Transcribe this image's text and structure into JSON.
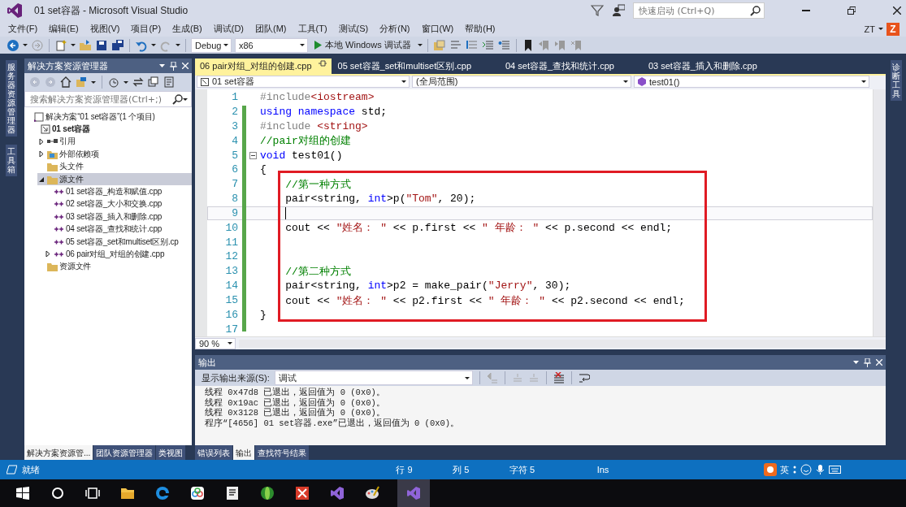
{
  "window": {
    "title": "01 set容器 - Microsoft Visual Studio",
    "quick_launch": {
      "placeholder": "快速启动 (Ctrl+Q)"
    },
    "account": {
      "name": "ZT",
      "initial": "Z"
    }
  },
  "menu": [
    "文件(F)",
    "编辑(E)",
    "视图(V)",
    "项目(P)",
    "生成(B)",
    "调试(D)",
    "团队(M)",
    "工具(T)",
    "测试(S)",
    "分析(N)",
    "窗口(W)",
    "帮助(H)"
  ],
  "toolbar": {
    "configuration": "Debug",
    "platform": "x86",
    "start": "本地 Windows 调试器"
  },
  "side_strips": {
    "left": [
      "服务器资源管理器",
      "工具箱"
    ],
    "right": [
      "诊断工具"
    ]
  },
  "solution_explorer": {
    "title": "解决方案资源管理器",
    "search": {
      "placeholder": "搜索解决方案资源管理器(Ctrl+;)"
    },
    "tree": [
      {
        "label": "解决方案“01 set容器”(1 个项目)",
        "kind": "solution",
        "selected": false,
        "children": [
          {
            "label": "01 set容器",
            "kind": "project",
            "selected": false,
            "children": [
              {
                "label": "引用",
                "kind": "references",
                "expanded": false,
                "selected": false
              },
              {
                "label": "外部依赖项",
                "kind": "dependencies",
                "expanded": false,
                "selected": false
              },
              {
                "label": "头文件",
                "kind": "folder",
                "selected": false
              },
              {
                "label": "源文件",
                "kind": "folder",
                "expanded": true,
                "selected": true,
                "children": [
                  {
                    "label": "01 set容器_构造和赋值.cpp",
                    "kind": "file",
                    "selected": false
                  },
                  {
                    "label": "02 set容器_大小和交换.cpp",
                    "kind": "file",
                    "selected": false
                  },
                  {
                    "label": "03 set容器_插入和删除.cpp",
                    "kind": "file",
                    "selected": false
                  },
                  {
                    "label": "04 set容器_查找和统计.cpp",
                    "kind": "file",
                    "selected": false
                  },
                  {
                    "label": "05 set容器_set和multiset区别.cp",
                    "kind": "file",
                    "selected": false
                  },
                  {
                    "label": "06 pair对组_对组的创建.cpp",
                    "kind": "file",
                    "expanded": false,
                    "selected": false
                  }
                ]
              },
              {
                "label": "资源文件",
                "kind": "folder",
                "selected": false
              }
            ]
          }
        ]
      }
    ],
    "tabs": [
      {
        "label": "解决方案资源管...",
        "selected": true
      },
      {
        "label": "团队资源管理器",
        "selected": false
      },
      {
        "label": "类视图",
        "selected": false
      }
    ]
  },
  "editor": {
    "tabs": [
      {
        "label": "06 pair对组_对组的创建.cpp",
        "selected": true
      },
      {
        "label": "05 set容器_set和multiset区别.cpp",
        "selected": false
      },
      {
        "label": "04 set容器_查找和统计.cpp",
        "selected": false
      },
      {
        "label": "03 set容器_插入和删除.cpp",
        "selected": false
      }
    ],
    "nav": [
      "01 set容器",
      "(全局范围)",
      "test01()"
    ],
    "lines": [
      {
        "number": "1",
        "current": false,
        "foldable": false,
        "tokens": [
          {
            "t": "#include",
            "kind": "pre"
          },
          {
            "t": "<iostream>",
            "kind": "inc"
          }
        ]
      },
      {
        "number": "2",
        "current": false,
        "foldable": false,
        "tokens": [
          {
            "t": "using namespace",
            "kind": "kw"
          },
          {
            "t": " std;",
            "kind": "plain"
          }
        ]
      },
      {
        "number": "3",
        "current": false,
        "foldable": false,
        "tokens": [
          {
            "t": "#include ",
            "kind": "pre"
          },
          {
            "t": "<string>",
            "kind": "inc"
          }
        ]
      },
      {
        "number": "4",
        "current": false,
        "foldable": false,
        "tokens": [
          {
            "t": "//pair对组的创建",
            "kind": "com"
          }
        ]
      },
      {
        "number": "5",
        "current": false,
        "foldable": true,
        "tokens": [
          {
            "t": "void",
            "kind": "kw"
          },
          {
            "t": " test01()",
            "kind": "plain"
          }
        ]
      },
      {
        "number": "6",
        "current": false,
        "foldable": false,
        "tokens": [
          {
            "t": "{",
            "kind": "plain"
          }
        ]
      },
      {
        "number": "7",
        "current": false,
        "foldable": false,
        "tokens": [
          {
            "t": "    //第一种方式",
            "kind": "com"
          }
        ]
      },
      {
        "number": "8",
        "current": false,
        "foldable": false,
        "tokens": [
          {
            "t": "    pair<string, ",
            "kind": "plain"
          },
          {
            "t": "int",
            "kind": "kw"
          },
          {
            "t": ">p(",
            "kind": "plain"
          },
          {
            "t": "\"Tom\"",
            "kind": "str"
          },
          {
            "t": ", 20);",
            "kind": "plain"
          }
        ]
      },
      {
        "number": "9",
        "current": true,
        "foldable": false
      },
      {
        "number": "10",
        "current": false,
        "foldable": false,
        "tokens": [
          {
            "t": "    cout << ",
            "kind": "plain"
          },
          {
            "t": "\"姓名： \"",
            "kind": "str"
          },
          {
            "t": " << p.first << ",
            "kind": "plain"
          },
          {
            "t": "\" 年龄： \"",
            "kind": "str"
          },
          {
            "t": " << p.second << endl;",
            "kind": "plain"
          }
        ]
      },
      {
        "number": "11",
        "current": false,
        "foldable": false
      },
      {
        "number": "12",
        "current": false,
        "foldable": false
      },
      {
        "number": "13",
        "current": false,
        "foldable": false,
        "tokens": [
          {
            "t": "    //第二种方式",
            "kind": "com"
          }
        ]
      },
      {
        "number": "14",
        "current": false,
        "foldable": false,
        "tokens": [
          {
            "t": "    pair<string, ",
            "kind": "plain"
          },
          {
            "t": "int",
            "kind": "kw"
          },
          {
            "t": ">p2 = make_pair(",
            "kind": "plain"
          },
          {
            "t": "\"Jerry\"",
            "kind": "str"
          },
          {
            "t": ", 30);",
            "kind": "plain"
          }
        ]
      },
      {
        "number": "15",
        "current": false,
        "foldable": false,
        "tokens": [
          {
            "t": "    cout << ",
            "kind": "plain"
          },
          {
            "t": "\"姓名： \"",
            "kind": "str"
          },
          {
            "t": " << p2.first << ",
            "kind": "plain"
          },
          {
            "t": "\" 年龄： \"",
            "kind": "str"
          },
          {
            "t": " << p2.second << endl;",
            "kind": "plain"
          }
        ]
      },
      {
        "number": "16",
        "current": false,
        "foldable": false,
        "tokens": [
          {
            "t": "}",
            "kind": "plain"
          }
        ]
      },
      {
        "number": "17",
        "current": false,
        "foldable": false
      }
    ],
    "zoom": "90 %"
  },
  "output": {
    "title": "输出",
    "source_label": "显示输出来源(S):",
    "source": "调试",
    "lines": [
      "线程 0x47d8 已退出，返回值为 0 (0x0)。",
      "线程 0x19ac 已退出，返回值为 0 (0x0)。",
      "线程 0x3128 已退出，返回值为 0 (0x0)。",
      "程序“[4656] 01 set容器.exe”已退出，返回值为 0 (0x0)。"
    ],
    "tabs": [
      {
        "label": "错误列表",
        "selected": false
      },
      {
        "label": "输出",
        "selected": true
      },
      {
        "label": "查找符号结果",
        "selected": false
      }
    ]
  },
  "status_bar": {
    "message": "就绪",
    "line": "行 9",
    "column": "列 5",
    "char": "字符 5",
    "mode": "Ins",
    "ime": "英"
  }
}
